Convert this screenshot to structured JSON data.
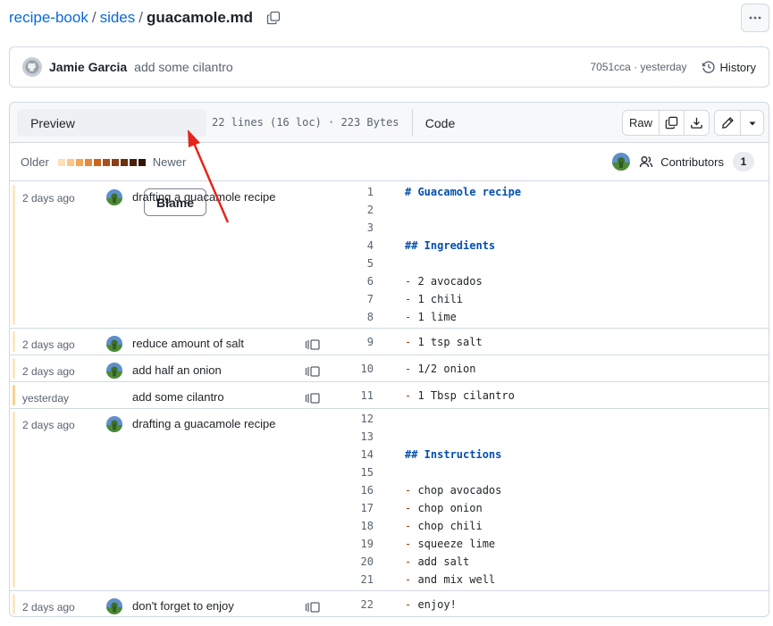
{
  "breadcrumb": {
    "repo": "recipe-book",
    "folder": "sides",
    "file": "guacamole.md",
    "separator": "/"
  },
  "latest_commit": {
    "author": "Jamie Garcia",
    "message": "add some cilantro",
    "meta": "7051cca · yesterday",
    "history_label": "History"
  },
  "file_tabs": {
    "preview": "Preview",
    "code": "Code",
    "blame": "Blame",
    "active": "Blame"
  },
  "file_info": "22 lines (16 loc) · 223 Bytes",
  "toolbar": {
    "raw_label": "Raw"
  },
  "age_legend": {
    "older": "Older",
    "newer": "Newer",
    "colors": [
      "#ffdfb6",
      "#ffc68a",
      "#f2a65a",
      "#e4883f",
      "#c8651c",
      "#a9511a",
      "#8a3f14",
      "#6b2f0d",
      "#4e200a",
      "#331404"
    ]
  },
  "contributors": {
    "label": "Contributors",
    "count": "1"
  },
  "colors": {
    "accent": "#0969da",
    "recent_bar": "#f5d394",
    "old_bar": "#fbe8c8",
    "annotation": "#e5251b"
  },
  "blame": {
    "hunks": [
      {
        "date": "2 days ago",
        "message": "drafting a guacamole recipe",
        "avatar": true,
        "reblame": false,
        "age": "old",
        "lines": [
          {
            "n": "1",
            "t": "# Guacamole recipe"
          },
          {
            "n": "2",
            "t": ""
          },
          {
            "n": "3",
            "t": ""
          },
          {
            "n": "4",
            "t": "## Ingredients"
          },
          {
            "n": "5",
            "t": ""
          },
          {
            "n": "6",
            "t": "- 2 avocados"
          },
          {
            "n": "7",
            "t": "- 1 chili"
          },
          {
            "n": "8",
            "t": "- 1 lime"
          }
        ]
      },
      {
        "date": "2 days ago",
        "message": "reduce amount of salt",
        "avatar": true,
        "reblame": true,
        "age": "old",
        "lines": [
          {
            "n": "9",
            "t": "- 1 tsp salt"
          }
        ]
      },
      {
        "date": "2 days ago",
        "message": "add half an onion",
        "avatar": true,
        "reblame": true,
        "age": "old",
        "lines": [
          {
            "n": "10",
            "t": "- 1/2 onion"
          }
        ]
      },
      {
        "date": "yesterday",
        "message": "add some cilantro",
        "avatar": false,
        "reblame": true,
        "age": "recent",
        "lines": [
          {
            "n": "11",
            "t": "- 1 Tbsp cilantro"
          }
        ]
      },
      {
        "date": "2 days ago",
        "message": "drafting a guacamole recipe",
        "avatar": true,
        "reblame": false,
        "age": "old",
        "lines": [
          {
            "n": "12",
            "t": ""
          },
          {
            "n": "13",
            "t": ""
          },
          {
            "n": "14",
            "t": "## Instructions"
          },
          {
            "n": "15",
            "t": ""
          },
          {
            "n": "16",
            "t": "- chop avocados"
          },
          {
            "n": "17",
            "t": "- chop onion"
          },
          {
            "n": "18",
            "t": "- chop chili"
          },
          {
            "n": "19",
            "t": "- squeeze lime"
          },
          {
            "n": "20",
            "t": "- add salt"
          },
          {
            "n": "21",
            "t": "- and mix well"
          }
        ]
      },
      {
        "date": "2 days ago",
        "message": "don't forget to enjoy",
        "avatar": true,
        "reblame": true,
        "age": "old",
        "lines": [
          {
            "n": "22",
            "t": "- enjoy!"
          }
        ]
      }
    ]
  }
}
